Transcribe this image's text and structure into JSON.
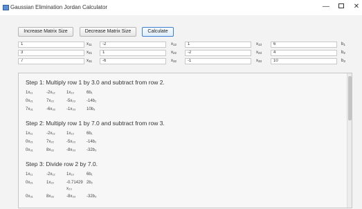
{
  "window": {
    "title": "Gaussian Elimination Jordan Calculator",
    "minimize_glyph": "—",
    "close_glyph": "✕"
  },
  "toolbar": {
    "increase_label": "Increase Matrix Size",
    "decrease_label": "Decrease Matrix Size",
    "calculate_label": "Calculate"
  },
  "matrix": {
    "rows": [
      {
        "a1": "1",
        "x1": "x",
        "x1_sub": "11",
        "a2": "-2",
        "x2": "x",
        "x2_sub": "12",
        "a3": "1",
        "x3": "x",
        "x3_sub": "13",
        "b": "6",
        "bv": "b",
        "bv_sub": "1"
      },
      {
        "a1": "3",
        "x1": "x",
        "x1_sub": "21",
        "a2": "1",
        "x2": "x",
        "x2_sub": "22",
        "a3": "-2",
        "x3": "x",
        "x3_sub": "23",
        "b": "4",
        "bv": "b",
        "bv_sub": "2"
      },
      {
        "a1": "7",
        "x1": "x",
        "x1_sub": "31",
        "a2": "-6",
        "x2": "x",
        "x2_sub": "32",
        "a3": "-1",
        "x3": "x",
        "x3_sub": "33",
        "b": "10",
        "bv": "b",
        "bv_sub": "3"
      }
    ]
  },
  "output": {
    "steps": [
      {
        "title": "Step 1: Multiply row 1 by 3.0 and subtract from row 2.",
        "rows": [
          [
            "1x₁₁",
            "-2x₁₂",
            "1x₁₃",
            "6b₁"
          ],
          [
            "0x₂₁",
            "7x₂₂",
            "-5x₂₃",
            "-14b₂"
          ],
          [
            "7x₃₁",
            "-6x₃₂",
            "-1x₃₃",
            "10b₃"
          ]
        ]
      },
      {
        "title": "Step 2: Multiply row 1 by 7.0 and subtract from row 3.",
        "rows": [
          [
            "1x₁₁",
            "-2x₁₂",
            "1x₁₃",
            "6b₁"
          ],
          [
            "0x₂₁",
            "7x₂₂",
            "-5x₂₃",
            "-14b₂"
          ],
          [
            "0x₃₁",
            "8x₃₂",
            "-8x₃₃",
            "-32b₃"
          ]
        ]
      },
      {
        "title": "Step 3: Divide row 2 by 7.0.",
        "rows": [
          [
            "1x₁₁",
            "-2x₁₂",
            "1x₁₃",
            "6b₁"
          ],
          [
            "0x₂₁",
            "1x₂₂",
            "-0.71429",
            "2b₂"
          ],
          [
            "",
            "",
            "x₂₃",
            ""
          ],
          [
            "0x₃₁",
            "8x₃₂",
            "-8x₃₃",
            "-32b₃"
          ]
        ]
      }
    ]
  }
}
